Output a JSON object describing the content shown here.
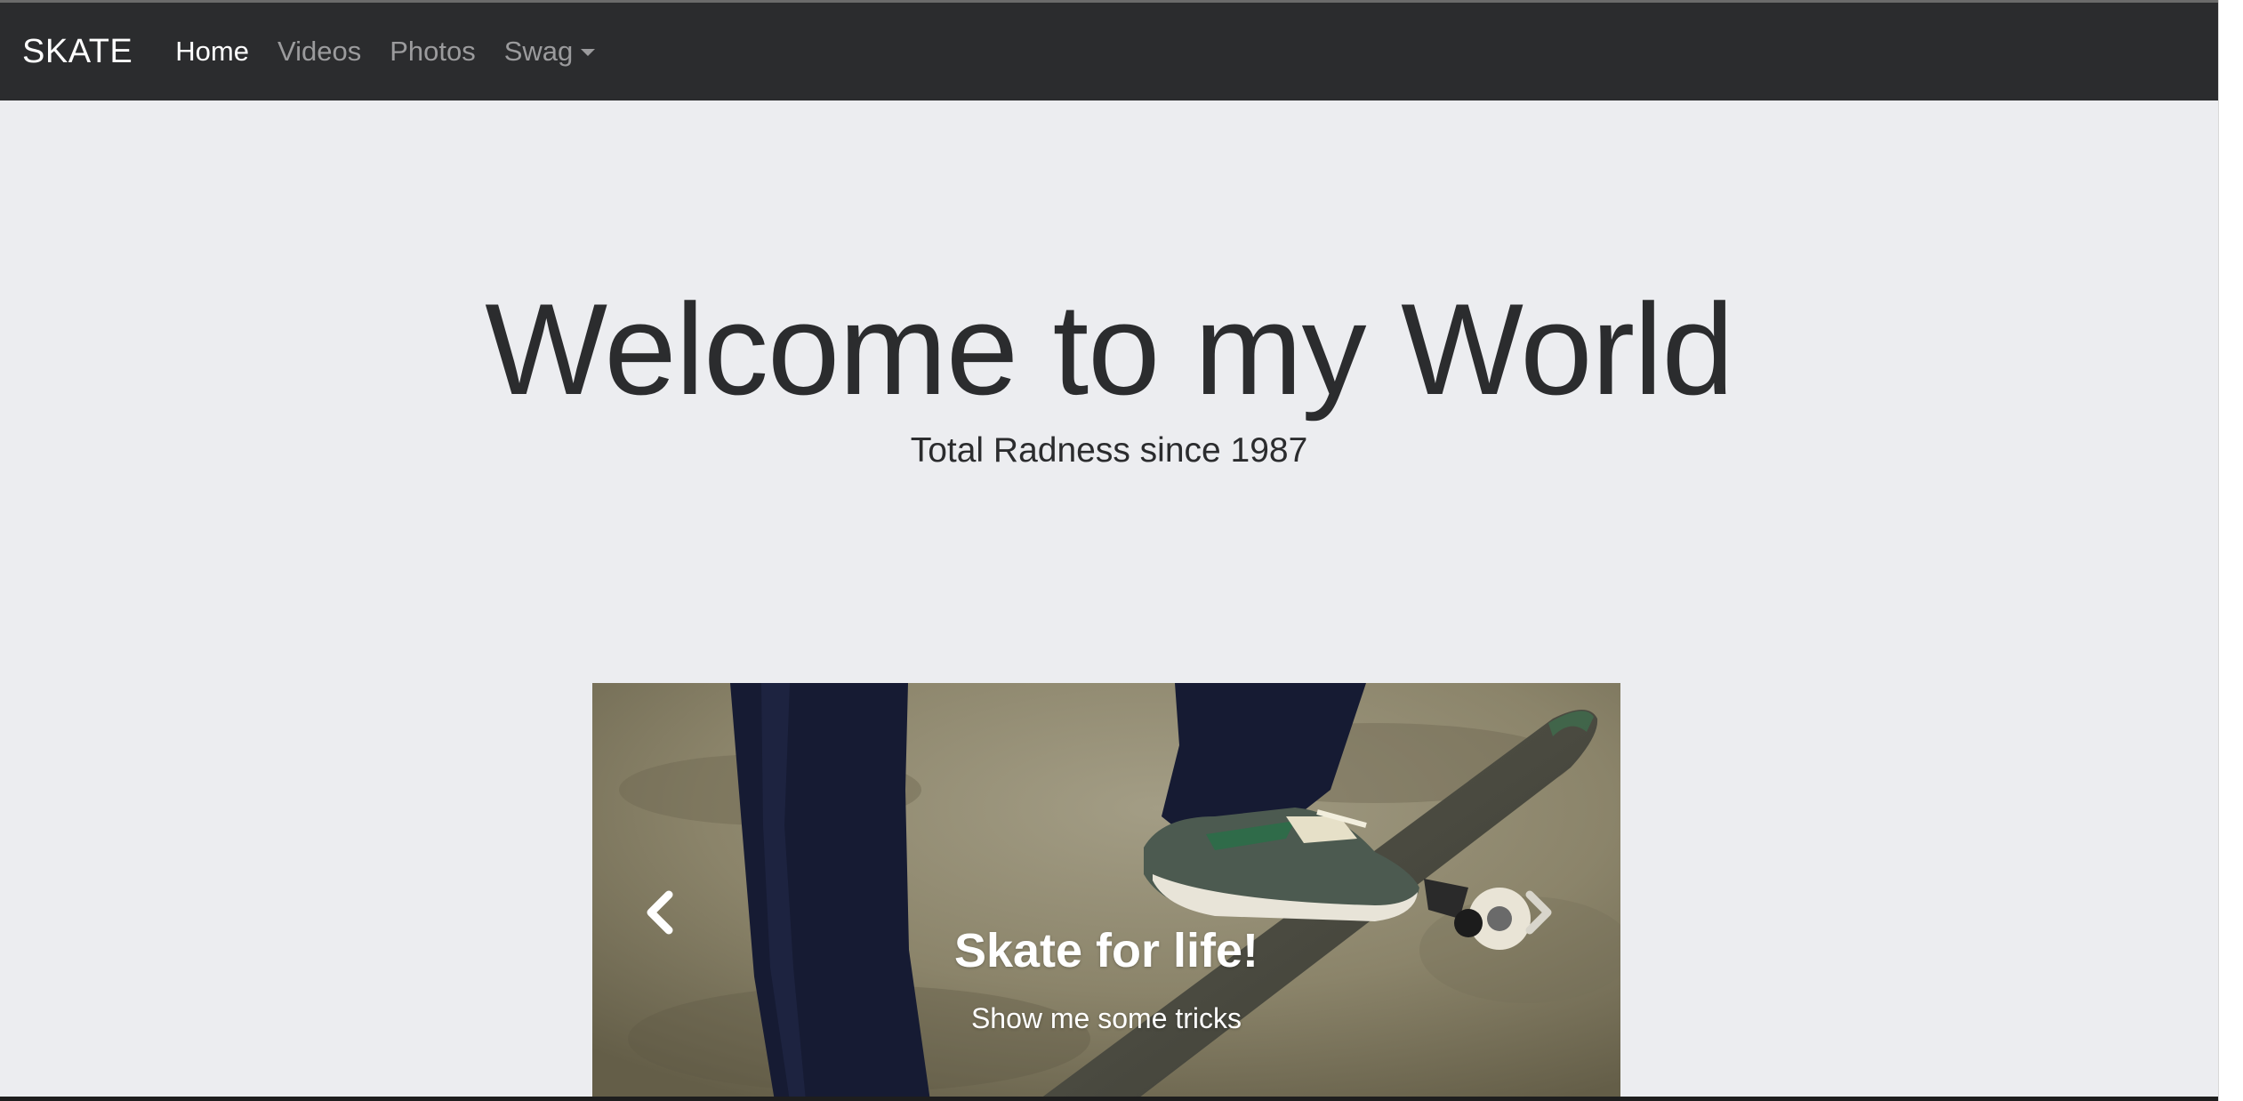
{
  "navbar": {
    "brand": "SKATE",
    "items": [
      {
        "label": "Home",
        "active": true
      },
      {
        "label": "Videos",
        "active": false
      },
      {
        "label": "Photos",
        "active": false
      },
      {
        "label": "Swag",
        "active": false,
        "dropdown": true
      }
    ]
  },
  "hero": {
    "title": "Welcome to my World",
    "subtitle": "Total Radness since 1987"
  },
  "carousel": {
    "caption_title": "Skate for life!",
    "caption_text": "Show me some tricks",
    "prev_icon": "chevron-left-icon",
    "next_icon": "chevron-right-icon"
  },
  "colors": {
    "navbar_bg": "#2b2c2e",
    "page_bg": "#ecedf0",
    "nav_inactive": "#9b9b9d",
    "nav_active": "#ffffff",
    "text": "#2b2c2e"
  }
}
